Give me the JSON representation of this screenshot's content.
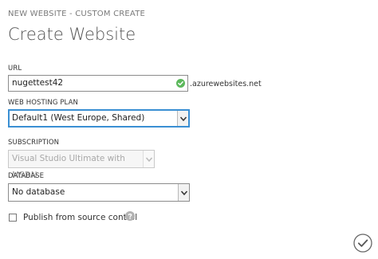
{
  "header": {
    "breadcrumb": "NEW WEBSITE - CUSTOM CREATE",
    "title": "Create Website"
  },
  "form": {
    "url": {
      "label": "URL",
      "value": "nugettest42",
      "suffix": ".azurewebsites.net",
      "status_icon": "check-circle-icon"
    },
    "hosting_plan": {
      "label": "WEB HOSTING PLAN",
      "selected": "Default1 (West Europe, Shared)"
    },
    "subscription": {
      "label": "SUBSCRIPTION",
      "selected": "Visual Studio Ultimate with MSDN"
    },
    "database": {
      "label": "DATABASE",
      "selected": "No database"
    },
    "publish_source_control": {
      "label": "Publish from source control",
      "checked": false,
      "help_icon": "question-circle-icon"
    }
  },
  "footer": {
    "confirm_icon": "checkmark-circle-icon"
  },
  "colors": {
    "valid_green": "#5cb85c",
    "focus_blue": "#3a8fd3",
    "text_dark": "#333333",
    "text_muted": "#7a7a7a"
  }
}
